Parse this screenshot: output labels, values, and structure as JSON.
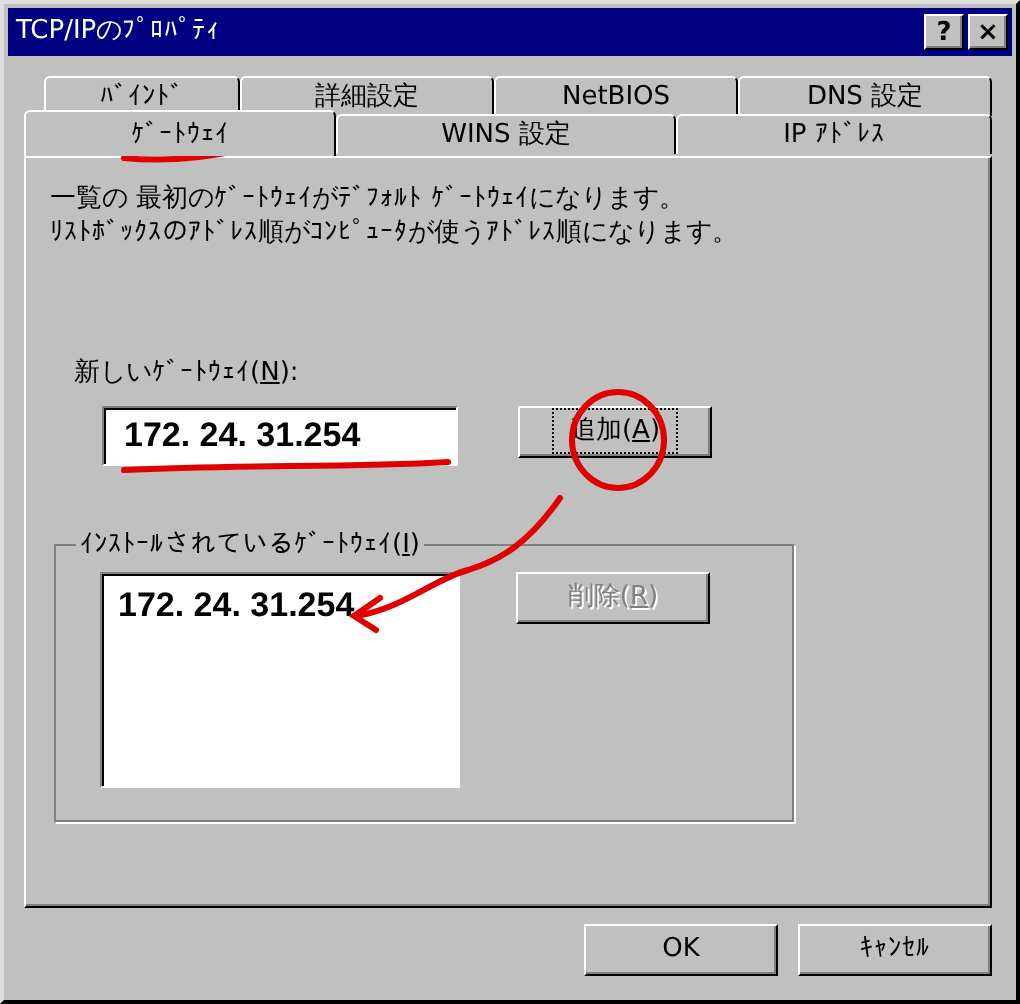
{
  "window": {
    "title": "TCP/IPのﾌﾟﾛﾊﾟﾃｨ",
    "title_buttons": [
      "?",
      "×"
    ]
  },
  "tab_rows": [
    {
      "tabs": [
        {
          "label": "ﾊﾞｲﾝﾄﾞ",
          "selected": false
        },
        {
          "label": "詳細設定",
          "selected": false
        },
        {
          "label": "NetBIOS",
          "selected": false
        },
        {
          "label": "DNS 設定",
          "selected": false
        }
      ]
    },
    {
      "tabs": [
        {
          "label": "ｹﾞｰﾄｳｪｲ",
          "selected": true
        },
        {
          "label": "WINS 設定",
          "selected": false
        },
        {
          "label": "IP ｱﾄﾞﾚｽ",
          "selected": false
        }
      ]
    }
  ],
  "description": [
    "一覧の 最初のｹﾞｰﾄｳｪｲがﾃﾞﾌｫﾙﾄ ｹﾞｰﾄｳｪｲになります。",
    "ﾘｽﾄﾎﾞｯｸｽのｱﾄﾞﾚｽ順がｺﾝﾋﾟｭｰﾀが使うｱﾄﾞﾚｽ順になります。"
  ],
  "new_gateway": {
    "label": "新しいｹﾞｰﾄｳｪｲ(N):",
    "value": "172. 24. 31.254",
    "button": {
      "label": "追加(A)",
      "focused": true,
      "disabled": false
    }
  },
  "installed_gateways": {
    "label": "ｲﾝｽﾄｰﾙされているｹﾞｰﾄｳｪｲ(I)",
    "items": [
      "172. 24. 31.254"
    ],
    "button": {
      "label": "削除(R)",
      "focused": false,
      "disabled": true
    }
  },
  "buttons": [
    {
      "label": "OK",
      "focused": false,
      "disabled": false
    },
    {
      "label": "ｷｬﾝｾﾙ",
      "focused": false,
      "disabled": false
    }
  ]
}
